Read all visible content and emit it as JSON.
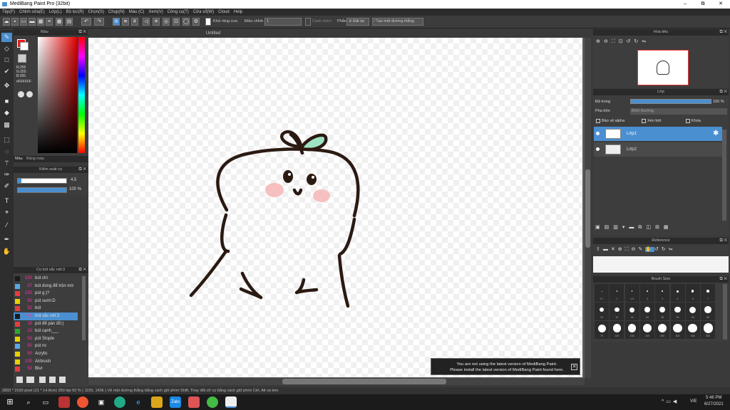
{
  "window": {
    "title": "MediBang Paint Pro (32bit)",
    "minimize": "–",
    "restore": "⧉",
    "close": "✕"
  },
  "menu": [
    "Tệp(F)",
    "Chỉnh sửa(E)",
    "Lớp(L)",
    "Bộ lọc(R)",
    "Chọn(S)",
    "Chụp(N)",
    "Màu (C)",
    "Xem(V)",
    "Công cụ(T)",
    "Cửa sổ(W)",
    "Cloud",
    "Help"
  ],
  "toolbar": {
    "antialias": "Khử răng cưa",
    "adjust_label": "Điều chỉnh",
    "adjust_value": "1",
    "snap": "Canh mềm",
    "rule": "Phẳng",
    "eraser": "Đặt lại",
    "line_tool": "Tạo một đường thẳng"
  },
  "document": {
    "tab": "Untitled"
  },
  "color_panel": {
    "title": "Màu",
    "r": "R:255",
    "g": "G:255",
    "b": "B:255",
    "hex": "#FFFFFF",
    "tab_color": "Màu",
    "tab_palette": "Bảng màu"
  },
  "brush_control": {
    "title": "Kiểm soát cọ",
    "size": "4.5",
    "opacity": "100 %",
    "size_fraction": 0.07,
    "opacity_fraction": 1.0
  },
  "brush_list": {
    "title": "Cọ bút sắc nét:3",
    "items": [
      {
        "size": "150",
        "label": "bút chì ",
        "color": "#1a1a1a"
      },
      {
        "size": "07",
        "label": "bút dùng để trộn mờ",
        "color": "#5aa9e6"
      },
      {
        "size": "150",
        "label": "pút g:)?",
        "color": "#e63c3c"
      },
      {
        "size": "50",
        "label": "pút sumi:D",
        "color": "#e8d000"
      },
      {
        "size": "52",
        "label": "bút",
        "color": "#e63c3c"
      },
      {
        "size": "4.5",
        "label": "bút sắc nét:3",
        "color": "#1a1a1a"
      },
      {
        "size": "15",
        "label": "pút để pán đồ:)",
        "color": "#e63c3c"
      },
      {
        "size": "10",
        "label": "bút cạnh___",
        "color": "#2ea82e"
      },
      {
        "size": "50",
        "label": "pút Stople",
        "color": "#e8d000"
      },
      {
        "size": "50",
        "label": "pút nc",
        "color": "#5aa9e6"
      },
      {
        "size": "50",
        "label": "Acrylic",
        "color": "#e8d000"
      },
      {
        "size": "100",
        "label": "Airbrush",
        "color": "#e8d000"
      },
      {
        "size": "50",
        "label": "Blur",
        "color": "#e63c3c"
      }
    ]
  },
  "navigator": {
    "title": "Hoa tiêu"
  },
  "layers": {
    "title": "Lớp",
    "opacity_label": "Độ trong",
    "opacity_value": "100 %",
    "blend_label": "Pha trộn",
    "blend_value": "Bình thường",
    "protect_alpha": "Bảo vệ alpha",
    "clip": "Xén bớt",
    "lock": "Khóa",
    "items": [
      {
        "name": "Lớp1"
      },
      {
        "name": "Lớp2"
      }
    ]
  },
  "reference": {
    "title": "Reference"
  },
  "brush_size": {
    "title": "Brush Size",
    "row1": [
      "0.7",
      "1",
      "1.5",
      "2",
      "3",
      "4",
      "5",
      "7"
    ],
    "row2": [
      "10",
      "12",
      "15",
      "20",
      "25",
      "30",
      "40",
      "50"
    ],
    "row3": [
      "70",
      "100",
      "150",
      "200",
      "250",
      "300",
      "400",
      "500"
    ]
  },
  "notice": {
    "line1": "You are not using the latest version of MediBang Paint.",
    "line2": "Please install the latest version of MediBang Paint found here."
  },
  "status": "2893 * 2039 pixel  (21 * 14.8cm)  350 dpi  50 %  ( 1155, 1406 )  Vẽ một đường thẳng bằng cách giữ phím Shift, Thay đổi cỡ cọ bằng cách giữ phím Ctrl, Alt và kéo",
  "taskbar": {
    "lang": "VIE",
    "time": "5:46 PM",
    "date": "6/27/2021"
  },
  "colors": {
    "accent": "#4a8fd0",
    "character": "#2b1a12",
    "leaf": "#9ee3c4",
    "blush": "#f7b6b6"
  }
}
